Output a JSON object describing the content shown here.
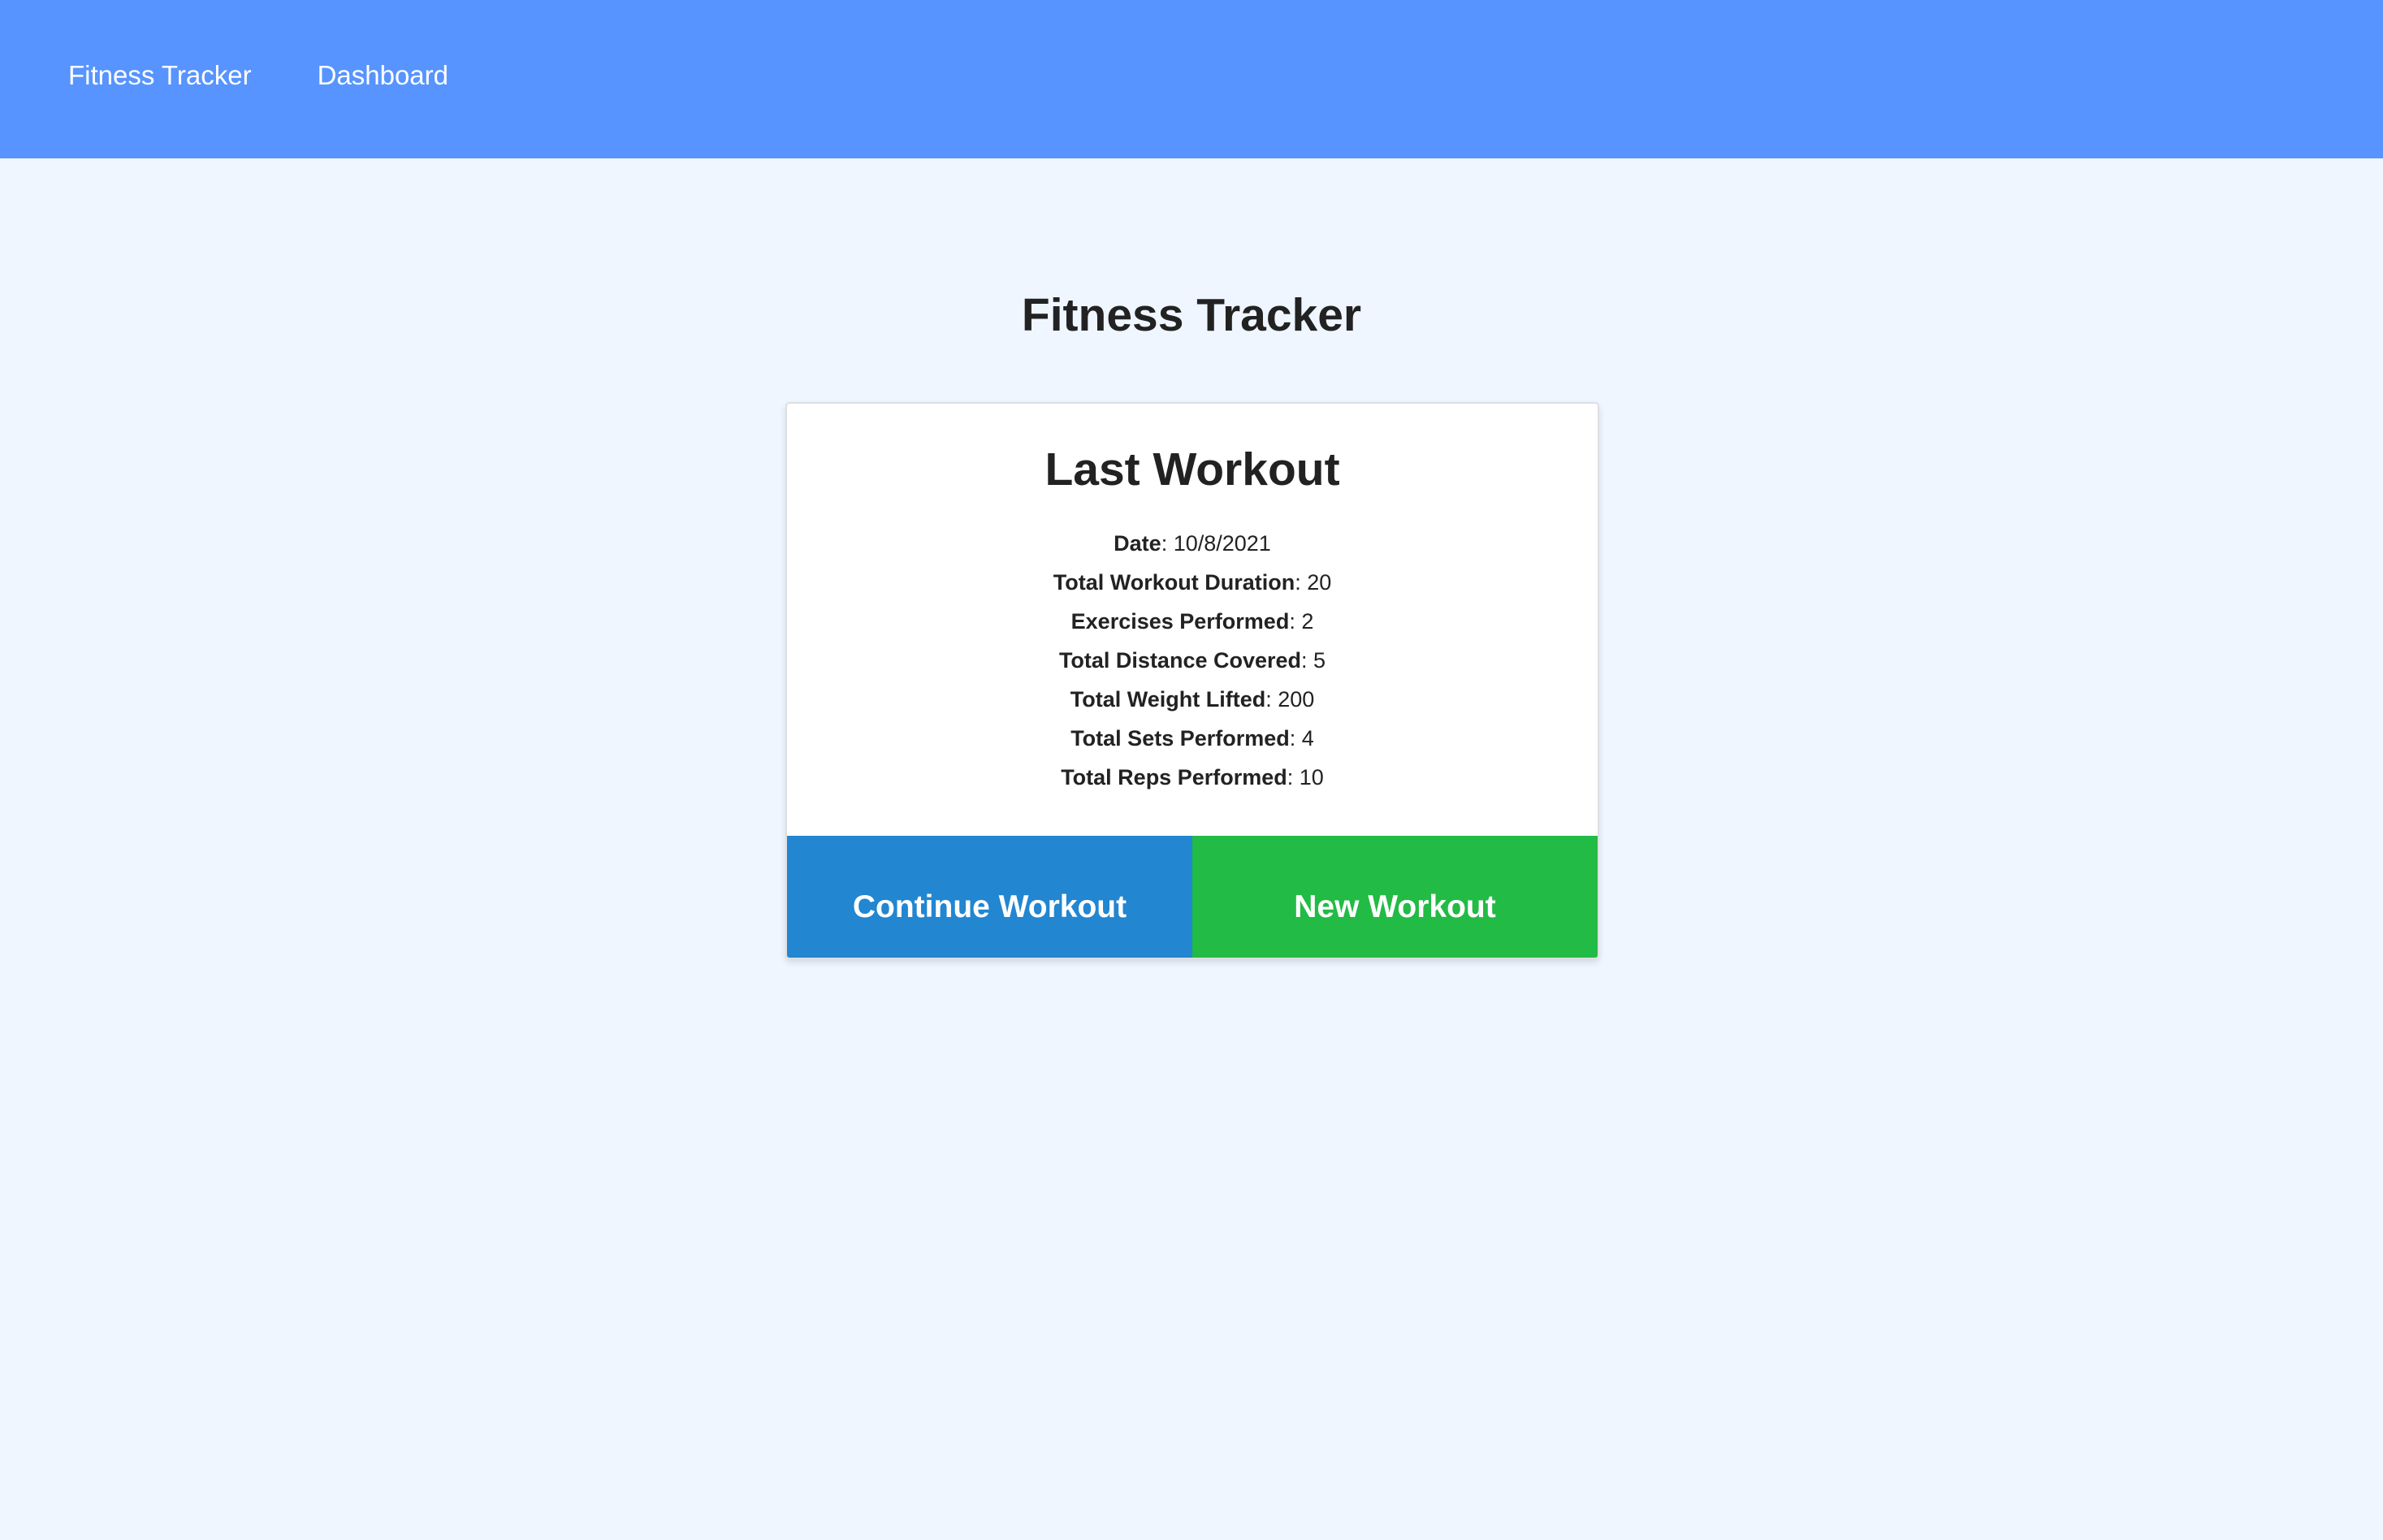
{
  "nav": {
    "brand": "Fitness Tracker",
    "dashboard": "Dashboard"
  },
  "page": {
    "title": "Fitness Tracker"
  },
  "card": {
    "title": "Last Workout",
    "stats": [
      {
        "label": "Date",
        "value": ": 10/8/2021"
      },
      {
        "label": "Total Workout Duration",
        "value": ": 20"
      },
      {
        "label": "Exercises Performed",
        "value": ": 2"
      },
      {
        "label": "Total Distance Covered",
        "value": ": 5"
      },
      {
        "label": "Total Weight Lifted",
        "value": ": 200"
      },
      {
        "label": "Total Sets Performed",
        "value": ": 4"
      },
      {
        "label": "Total Reps Performed",
        "value": ": 10"
      }
    ],
    "continue_label": "Continue Workout",
    "new_label": "New Workout"
  },
  "colors": {
    "navbar": "#5794ff",
    "background": "#eff6ff",
    "continue_button": "#2286d1",
    "new_button": "#22bb45"
  }
}
